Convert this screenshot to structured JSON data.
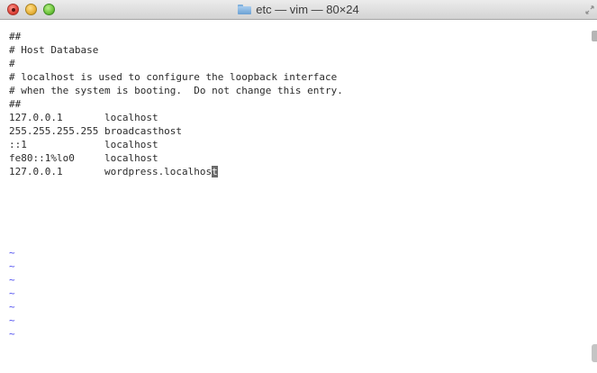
{
  "window": {
    "title": "etc — vim — 80×24"
  },
  "buffer": {
    "lines": [
      "##",
      "# Host Database",
      "#",
      "# localhost is used to configure the loopback interface",
      "# when the system is booting.  Do not change this entry.",
      "##",
      "127.0.0.1       localhost",
      "255.255.255.255 broadcasthost",
      "::1             localhost",
      "fe80::1%lo0     localhost"
    ],
    "cursor_line_before": "127.0.0.1       wordpress.localhos",
    "cursor_char": "t",
    "tilde": "~",
    "tilde_count": 7
  },
  "colors": {
    "tilde": "#4d4df0",
    "cursor": "#6a6a6a",
    "text": "#2b2b2b"
  }
}
